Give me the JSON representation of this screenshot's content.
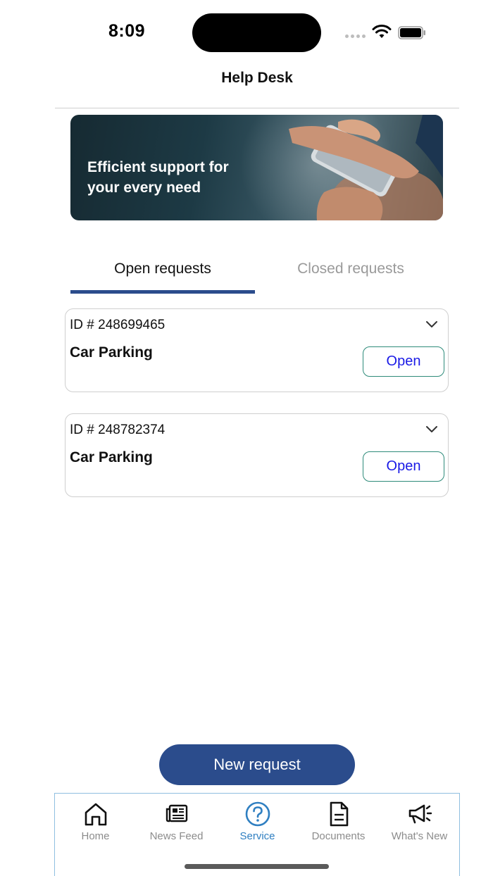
{
  "status_bar": {
    "time": "8:09"
  },
  "header": {
    "title": "Help Desk"
  },
  "banner": {
    "text": "Efficient support for your every need"
  },
  "tabs": [
    {
      "label": "Open requests",
      "active": true
    },
    {
      "label": "Closed requests",
      "active": false
    }
  ],
  "requests": [
    {
      "id": "ID # 248699465",
      "title": "Car Parking",
      "status": "Open"
    },
    {
      "id": "ID # 248782374",
      "title": "Car Parking",
      "status": "Open"
    }
  ],
  "new_request_label": "New request",
  "nav": [
    {
      "label": "Home",
      "icon": "home-icon"
    },
    {
      "label": "News Feed",
      "icon": "news-feed-icon"
    },
    {
      "label": "Service",
      "icon": "question-circle-icon",
      "active": true
    },
    {
      "label": "Documents",
      "icon": "document-icon"
    },
    {
      "label": "What's New",
      "icon": "megaphone-icon"
    }
  ],
  "colors": {
    "primary": "#2b4c8c",
    "status_border": "#2e8b7a",
    "status_text": "#1a1ae6",
    "nav_active": "#2f7fc1"
  }
}
